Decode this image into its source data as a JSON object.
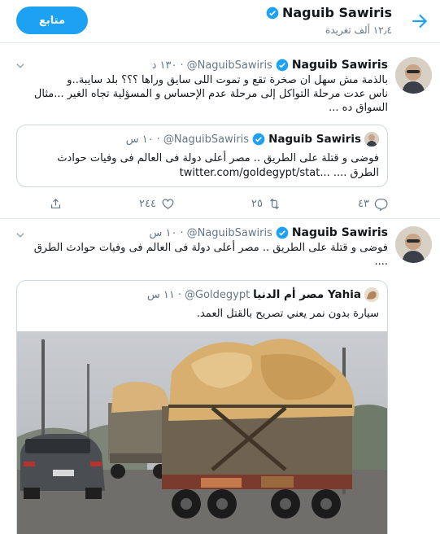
{
  "header": {
    "name": "Naguib Sawiris",
    "tweet_count": "١٢٫٤ ألف تغريدة",
    "follow_label": "متابع"
  },
  "tweets": [
    {
      "name": "Naguib Sawiris",
      "handle": "@NaguibSawiris",
      "time": "١٣٠ د",
      "text_line1": "بالذمة مش سهل ان صخرة تقع و تموت اللى سايق وراها ؟؟؟           بلد سايبة..و",
      "text_line2": "ناس عدت مرحلة التواكل إلى مرحلة عدم الإحساس و المسؤلية تجاه الغير ...مثال",
      "text_line3": "السواق ده ...",
      "quote": {
        "name": "Naguib Sawiris",
        "handle": "@NaguibSawiris",
        "time": "١٠ س",
        "text_line1": "فوضى و قتلة على الطريق .. مصر أعلى دولة فى العالم فى وفيات حوادث",
        "text_line2": "الطرق .... ...twitter.com/goldegypt/stat"
      },
      "actions": {
        "replies": "٤٣",
        "retweets": "٢٥",
        "likes": "٢٤٤"
      }
    },
    {
      "name": "Naguib Sawiris",
      "handle": "@NaguibSawiris",
      "time": "١٠ س",
      "text_line1": "فوضى و قتلة على الطريق .. مصر أعلى دولة فى العالم فى وفيات حوادث الطرق",
      "text_line2": "....",
      "quote": {
        "name": "مصر أم الدنيا Yahia",
        "handle": "@Goldegypt",
        "time": "١١ س",
        "text": "سيارة بدون نمر يعني تصريح بالقتل العمد."
      }
    }
  ],
  "colors": {
    "accent": "#1da1f2",
    "secondary_text": "#657786",
    "border": "#e6ecf0"
  }
}
